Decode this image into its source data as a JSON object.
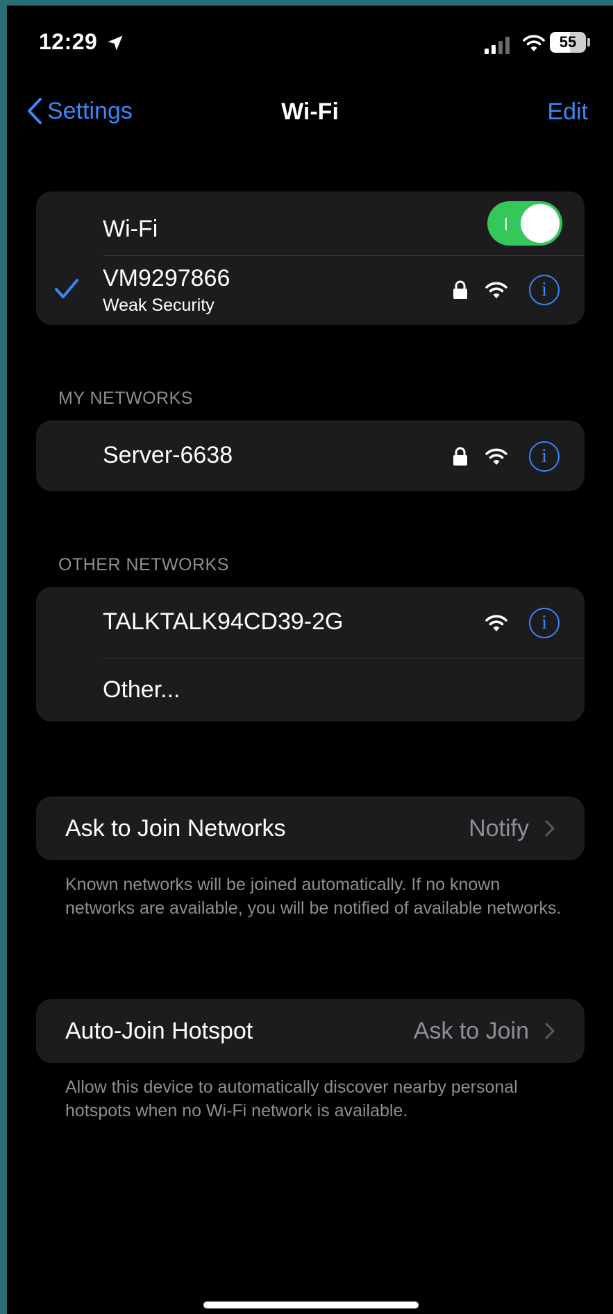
{
  "status_bar": {
    "time": "12:29",
    "battery": "55"
  },
  "nav": {
    "back_label": "Settings",
    "title": "Wi-Fi",
    "edit_label": "Edit"
  },
  "wifi_toggle": {
    "label": "Wi-Fi",
    "on": true
  },
  "connected_network": {
    "name": "VM9297866",
    "subtitle": "Weak Security",
    "secured": true
  },
  "my_networks": {
    "header": "MY NETWORKS",
    "items": [
      {
        "name": "Server-6638",
        "secured": true
      }
    ]
  },
  "other_networks": {
    "header": "OTHER NETWORKS",
    "items": [
      {
        "name": "TALKTALK94CD39-2G",
        "secured": false
      }
    ],
    "other_label": "Other..."
  },
  "ask_to_join": {
    "label": "Ask to Join Networks",
    "value": "Notify",
    "footer": "Known networks will be joined automatically. If no known networks are available, you will be notified of available networks."
  },
  "auto_join_hotspot": {
    "label": "Auto-Join Hotspot",
    "value": "Ask to Join",
    "footer": "Allow this device to automatically discover nearby personal hotspots when no Wi-Fi network is available."
  },
  "colors": {
    "accent": "#3a87f7",
    "toggle_on": "#34c759",
    "cell_bg": "#1c1c1e"
  }
}
